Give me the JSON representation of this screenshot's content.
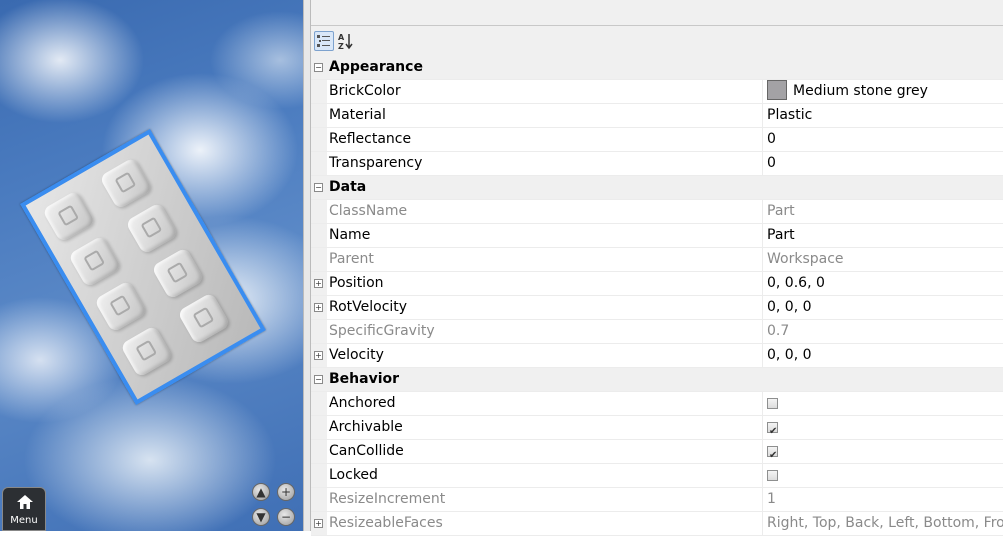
{
  "viewport": {
    "menu_label": "Menu"
  },
  "properties": [
    {
      "type": "category",
      "name": "Appearance"
    },
    {
      "type": "prop",
      "name": "BrickColor",
      "value": "Medium stone grey",
      "swatch": "#a3a2a5"
    },
    {
      "type": "prop",
      "name": "Material",
      "value": "Plastic"
    },
    {
      "type": "prop",
      "name": "Reflectance",
      "value": "0"
    },
    {
      "type": "prop",
      "name": "Transparency",
      "value": "0"
    },
    {
      "type": "category",
      "name": "Data"
    },
    {
      "type": "prop",
      "name": "ClassName",
      "value": "Part",
      "readonly": true
    },
    {
      "type": "prop",
      "name": "Name",
      "value": "Part"
    },
    {
      "type": "prop",
      "name": "Parent",
      "value": "Workspace",
      "readonly": true
    },
    {
      "type": "prop",
      "name": "Position",
      "value": "0, 0.6, 0",
      "expandable": true
    },
    {
      "type": "prop",
      "name": "RotVelocity",
      "value": "0, 0, 0",
      "expandable": true
    },
    {
      "type": "prop",
      "name": "SpecificGravity",
      "value": "0.7",
      "readonly": true
    },
    {
      "type": "prop",
      "name": "Velocity",
      "value": "0, 0, 0",
      "expandable": true
    },
    {
      "type": "category",
      "name": "Behavior"
    },
    {
      "type": "prop",
      "name": "Anchored",
      "checkbox": true,
      "checked": false
    },
    {
      "type": "prop",
      "name": "Archivable",
      "checkbox": true,
      "checked": true
    },
    {
      "type": "prop",
      "name": "CanCollide",
      "checkbox": true,
      "checked": true
    },
    {
      "type": "prop",
      "name": "Locked",
      "checkbox": true,
      "checked": false
    },
    {
      "type": "prop",
      "name": "ResizeIncrement",
      "value": "1",
      "readonly": true
    },
    {
      "type": "prop",
      "name": "ResizeableFaces",
      "value": "Right, Top, Back, Left, Bottom, Front",
      "readonly": true,
      "expandable": true
    }
  ],
  "colors": {
    "selection": "#3a8df0",
    "sky": "#4a7bbf"
  }
}
